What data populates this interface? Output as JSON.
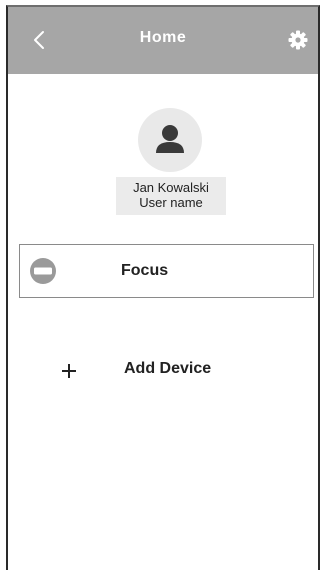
{
  "header": {
    "title": "Home",
    "back_icon": "chevron-left-icon",
    "settings_icon": "gear-icon",
    "background_color": "#a6a6a6"
  },
  "profile": {
    "avatar_icon": "user-icon",
    "name": "Jan Kowalski",
    "subtitle": "User name"
  },
  "devices": [
    {
      "label": "Focus",
      "icon": "device-icon"
    }
  ],
  "add_device": {
    "icon": "plus-icon",
    "label": "Add Device"
  }
}
